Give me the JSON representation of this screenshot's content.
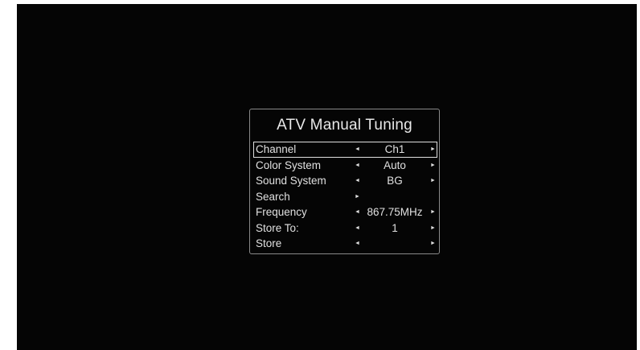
{
  "menu": {
    "title": "ATV Manual Tuning",
    "left_arrow": "◄",
    "right_arrow": "►",
    "rows": [
      {
        "label": "Channel",
        "value": "Ch1"
      },
      {
        "label": "Color System",
        "value": "Auto"
      },
      {
        "label": "Sound System",
        "value": "BG"
      },
      {
        "label": "Search",
        "value": ""
      },
      {
        "label": "Frequency",
        "value": "867.75MHz"
      },
      {
        "label": "Store To:",
        "value": "1"
      },
      {
        "label": "Store",
        "value": ""
      }
    ],
    "selected_index": 0
  },
  "colors": {
    "screen_bg": "#050505",
    "text": "#e0e0e0",
    "border": "#8a8a8a"
  }
}
